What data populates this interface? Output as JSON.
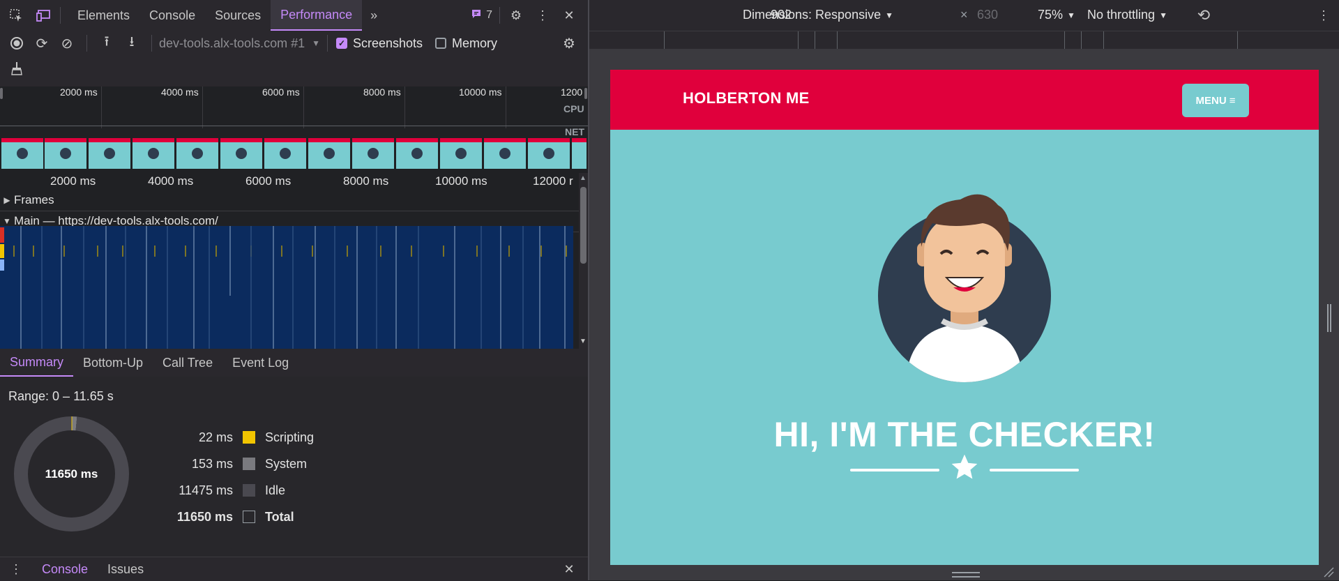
{
  "tabs": {
    "items": [
      "Elements",
      "Console",
      "Sources",
      "Performance"
    ],
    "issues_count": "7"
  },
  "toolbar": {
    "target": "dev-tools.alx-tools.com #1",
    "screenshots_label": "Screenshots",
    "memory_label": "Memory"
  },
  "overview": {
    "ticks": [
      "2000 ms",
      "4000 ms",
      "6000 ms",
      "8000 ms",
      "10000 ms",
      "1200"
    ],
    "cpu_label": "CPU",
    "net_label": "NET"
  },
  "timeline": {
    "ticks": [
      "2000 ms",
      "4000 ms",
      "6000 ms",
      "8000 ms",
      "10000 ms",
      "12000 r"
    ],
    "frames_label": "Frames",
    "main_label": "Main — https://dev-tools.alx-tools.com/"
  },
  "summary_tabs": [
    "Summary",
    "Bottom-Up",
    "Call Tree",
    "Event Log"
  ],
  "summary": {
    "range": "Range: 0 – 11.65 s",
    "total_center": "11650 ms",
    "rows": [
      {
        "value": "22 ms",
        "label": "Scripting",
        "color": "#f2c500"
      },
      {
        "value": "153 ms",
        "label": "System",
        "color": "#7a7a7f"
      },
      {
        "value": "11475 ms",
        "label": "Idle",
        "color": "#4a4950"
      },
      {
        "value": "11650 ms",
        "label": "Total",
        "color": "transparent"
      }
    ]
  },
  "drawer": {
    "console": "Console",
    "issues": "Issues"
  },
  "device": {
    "dimensions": "Dimensions: Responsive",
    "width": "902",
    "height": "630",
    "zoom": "75%",
    "throttling": "No throttling"
  },
  "page": {
    "brand": "HOLBERTON ME",
    "menu": "MENU",
    "title": "HI, I'M THE CHECKER!"
  },
  "colors": {
    "accent": "#c58af9",
    "brand_red": "#e0003c",
    "teal": "#78cbcf"
  }
}
